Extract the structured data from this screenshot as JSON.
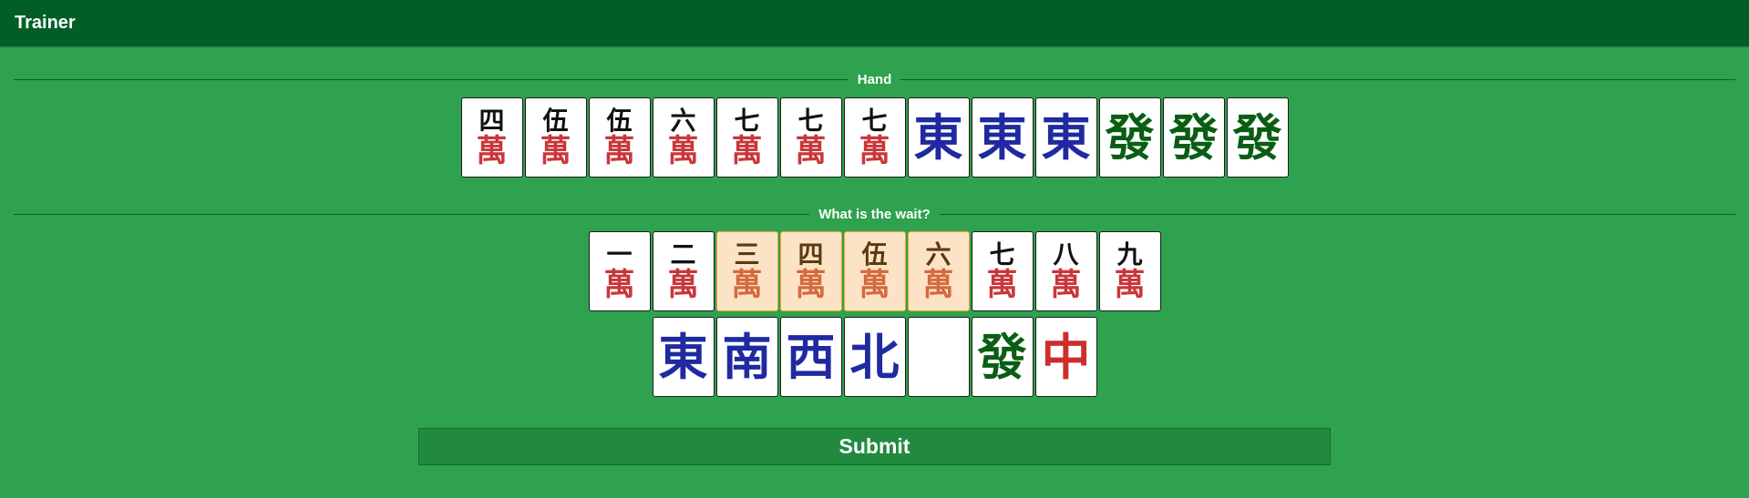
{
  "app": {
    "title": "Trainer"
  },
  "hand": {
    "label": "Hand",
    "tiles": [
      {
        "top": "四",
        "bot": "萬"
      },
      {
        "top": "伍",
        "bot": "萬"
      },
      {
        "top": "伍",
        "bot": "萬"
      },
      {
        "top": "六",
        "bot": "萬"
      },
      {
        "top": "七",
        "bot": "萬"
      },
      {
        "top": "七",
        "bot": "萬"
      },
      {
        "top": "七",
        "bot": "萬"
      },
      {
        "honor": "東",
        "color": "#1f2aa0"
      },
      {
        "honor": "東",
        "color": "#1f2aa0"
      },
      {
        "honor": "東",
        "color": "#1f2aa0"
      },
      {
        "honor": "發",
        "color": "#0a5e14"
      },
      {
        "honor": "發",
        "color": "#0a5e14"
      },
      {
        "honor": "發",
        "color": "#0a5e14"
      }
    ]
  },
  "wait": {
    "label": "What is the wait?",
    "number_tiles": [
      {
        "top": "一",
        "bot": "萬",
        "selected": false
      },
      {
        "top": "二",
        "bot": "萬",
        "selected": false
      },
      {
        "top": "三",
        "bot": "萬",
        "selected": true
      },
      {
        "top": "四",
        "bot": "萬",
        "selected": true
      },
      {
        "top": "伍",
        "bot": "萬",
        "selected": true
      },
      {
        "top": "六",
        "bot": "萬",
        "selected": true
      },
      {
        "top": "七",
        "bot": "萬",
        "selected": false
      },
      {
        "top": "八",
        "bot": "萬",
        "selected": false
      },
      {
        "top": "九",
        "bot": "萬",
        "selected": false
      }
    ],
    "honor_tiles": [
      {
        "honor": "東",
        "color": "#1f2aa0",
        "icon": "east-wind-icon"
      },
      {
        "honor": "南",
        "color": "#1f2aa0",
        "icon": "south-wind-icon"
      },
      {
        "honor": "西",
        "color": "#1f2aa0",
        "icon": "west-wind-icon"
      },
      {
        "honor": "北",
        "color": "#1f2aa0",
        "icon": "north-wind-icon"
      },
      {
        "honor": "",
        "color": "#1f2aa0",
        "icon": "white-dragon-icon"
      },
      {
        "honor": "發",
        "color": "#0a5e14",
        "icon": "green-dragon-icon"
      },
      {
        "honor": "中",
        "color": "#cc2e2e",
        "icon": "red-dragon-icon"
      }
    ]
  },
  "submit": {
    "label": "Submit"
  },
  "colors": {
    "background": "#2ea24e",
    "topbar": "#005e26",
    "selected_tile": "#fde3c5",
    "selected_border": "#f3a02a",
    "suit_red": "#c9373a"
  }
}
